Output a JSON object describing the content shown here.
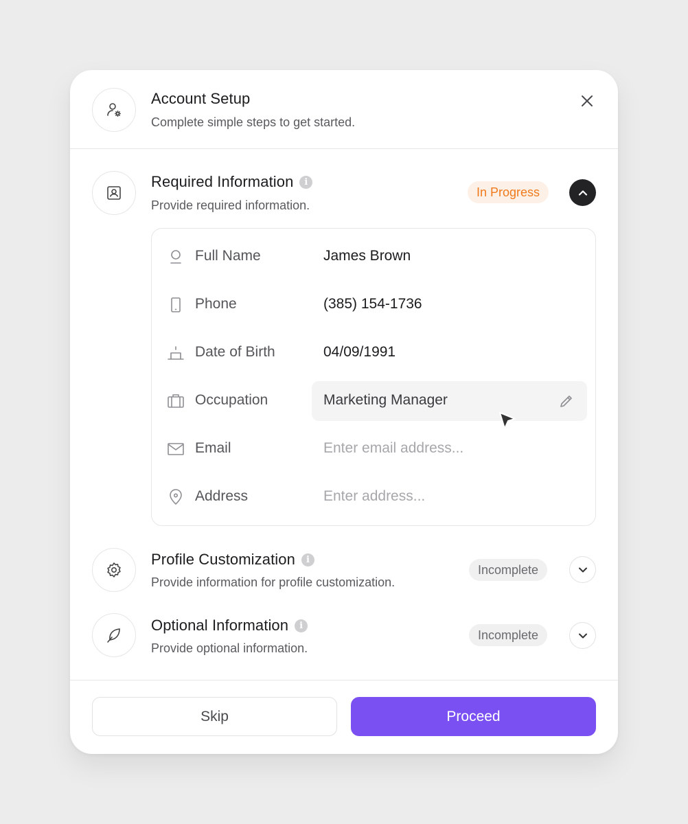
{
  "header": {
    "title": "Account Setup",
    "subtitle": "Complete simple steps to get started.",
    "icon": "user-gear-icon",
    "close_icon": "close-icon"
  },
  "sections": [
    {
      "title": "Required Information",
      "subtitle": "Provide required information.",
      "status": "In Progress",
      "icon": "contact-card-icon",
      "expanded": true,
      "fields": [
        {
          "label": "Full Name",
          "value": "James Brown",
          "icon": "user-icon"
        },
        {
          "label": "Phone",
          "value": "(385) 154-1736",
          "icon": "phone-icon"
        },
        {
          "label": "Date of Birth",
          "value": "04/09/1991",
          "icon": "cake-icon"
        },
        {
          "label": "Occupation",
          "value": "Marketing Manager",
          "icon": "briefcase-icon",
          "editing": true
        },
        {
          "label": "Email",
          "value": "",
          "placeholder": "Enter email address...",
          "icon": "mail-icon"
        },
        {
          "label": "Address",
          "value": "",
          "placeholder": "Enter address...",
          "icon": "location-pin-icon"
        }
      ]
    },
    {
      "title": "Profile Customization",
      "subtitle": "Provide information for profile customization.",
      "status": "Incomplete",
      "icon": "gear-icon",
      "expanded": false
    },
    {
      "title": "Optional Information",
      "subtitle": "Provide optional information.",
      "status": "Incomplete",
      "icon": "feather-icon",
      "expanded": false
    }
  ],
  "info_glyph": "i",
  "footer": {
    "skip_label": "Skip",
    "proceed_label": "Proceed"
  },
  "colors": {
    "accent": "#7b50f2",
    "in_progress_text": "#f07a1c",
    "in_progress_bg": "#fdf0e6",
    "incomplete_bg": "#f0f0f1"
  }
}
